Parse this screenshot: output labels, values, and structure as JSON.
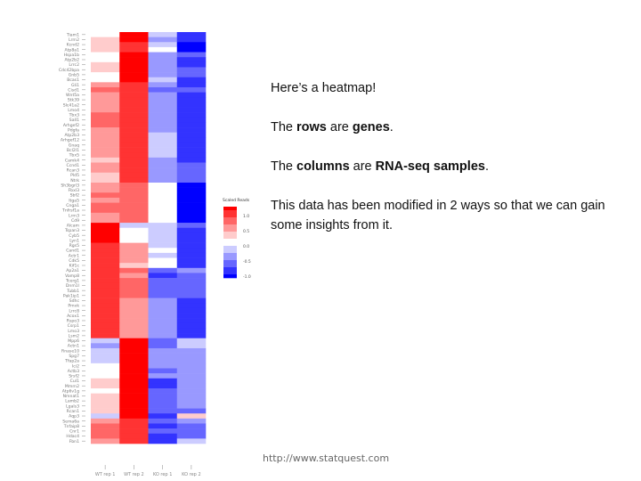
{
  "slide": {
    "notes": [
      {
        "parts": [
          {
            "t": "Here’s a heatmap!",
            "b": false
          }
        ]
      },
      {
        "parts": [
          {
            "t": "The ",
            "b": false
          },
          {
            "t": "rows",
            "b": true
          },
          {
            "t": " are ",
            "b": false
          },
          {
            "t": "genes",
            "b": true
          },
          {
            "t": ".",
            "b": false
          }
        ]
      },
      {
        "parts": [
          {
            "t": "The ",
            "b": false
          },
          {
            "t": "columns",
            "b": true
          },
          {
            "t": " are ",
            "b": false
          },
          {
            "t": "RNA-seq samples",
            "b": true
          },
          {
            "t": ".",
            "b": false
          }
        ]
      },
      {
        "parts": [
          {
            "t": "This data has been modified in 2 ways so that we can gain some insights from it.",
            "b": false
          }
        ]
      }
    ],
    "footer": "http://www.statquest.com"
  },
  "chart_data": {
    "type": "heatmap",
    "title": "",
    "xlabel": "",
    "ylabel": "",
    "color_key": {
      "title": "Scaled Reads",
      "ticks": [
        "1.0",
        "0.5",
        "0.0",
        "-0.5",
        "-1.0"
      ],
      "range": [
        -1,
        1
      ],
      "low_color": "#0000ff",
      "mid_color": "#ffffff",
      "high_color": "#ff0000"
    },
    "columns": [
      "WT rep 1",
      "WT rep 2",
      "KO rep 1",
      "KO rep 2"
    ],
    "rows": [
      "Tiam1",
      "Lrrn2",
      "Kcnd2",
      "Atp8a1",
      "Hspa1b",
      "Atp2b2",
      "Lrrc2",
      "Cdc42bpa",
      "Gnb5",
      "Bcas1",
      "Gli1",
      "Cisd1",
      "Wnt5a",
      "Stk39",
      "Slc41a2",
      "Lmo4",
      "Tbx3",
      "Sall1",
      "Arhgef2",
      "Pdgfa",
      "Atp2b3",
      "Arhgef12",
      "Gnaq",
      "Bcl2l1",
      "Tbx5",
      "Camk4",
      "Ccnd1",
      "Rcan3",
      "Pld5",
      "Ntrk",
      "Sh3bgrl3",
      "Fbxl3",
      "Sbf2",
      "Itga5",
      "Cnga1",
      "Tnfrsf1a",
      "Lrrn3",
      "Cd9",
      "Alcam",
      "Tspan3",
      "Cyb5",
      "Lyn1",
      "Rgs5",
      "Cand1",
      "Actr1",
      "Cdk5",
      "Kif1c",
      "Ap2a1",
      "Vamp8",
      "Tcerg1",
      "Dnm1l",
      "Tubb1",
      "Pak1ip1",
      "Sdhc",
      "Pmvk",
      "Lrrc8",
      "Acox1",
      "Rspo3",
      "Csrp1",
      "Lmo3",
      "Lsm2",
      "Mpp6",
      "Actn1",
      "Rnase10",
      "Spg7",
      "Tfap2a",
      "Ici2",
      "Actb3",
      "Srsf2",
      "Cul1",
      "Mmrn2",
      "Atp6v1g",
      "Nmnat1",
      "Lamb2",
      "Lgals3",
      "Rcan1",
      "Aqp3",
      "Sema6a",
      "Tnfaip8",
      "Cnr1",
      "Hdac4",
      "Fbn1"
    ],
    "values": [
      [
        0.08,
        0.92,
        -0.3,
        -0.78
      ],
      [
        0.1,
        0.92,
        -0.35,
        -0.8
      ],
      [
        0.12,
        0.88,
        -0.15,
        -0.9
      ],
      [
        0.22,
        0.85,
        -0.1,
        -0.92
      ],
      [
        0.04,
        0.95,
        -0.45,
        -0.7
      ],
      [
        0.05,
        0.95,
        -0.4,
        -0.72
      ],
      [
        0.1,
        0.93,
        -0.38,
        -0.75
      ],
      [
        0.12,
        0.95,
        -0.4,
        -0.7
      ],
      [
        -0.08,
        0.98,
        -0.32,
        -0.68
      ],
      [
        -0.1,
        0.97,
        -0.28,
        -0.72
      ],
      [
        0.45,
        0.8,
        -0.5,
        -0.72
      ],
      [
        0.5,
        0.78,
        -0.52,
        -0.7
      ],
      [
        0.38,
        0.8,
        -0.4,
        -0.75
      ],
      [
        0.4,
        0.8,
        -0.38,
        -0.75
      ],
      [
        0.42,
        0.78,
        -0.4,
        -0.76
      ],
      [
        0.48,
        0.8,
        -0.45,
        -0.75
      ],
      [
        0.52,
        0.72,
        -0.42,
        -0.76
      ],
      [
        0.5,
        0.72,
        -0.4,
        -0.78
      ],
      [
        0.55,
        0.7,
        -0.45,
        -0.78
      ],
      [
        0.48,
        0.72,
        -0.38,
        -0.8
      ],
      [
        0.4,
        0.75,
        -0.3,
        -0.82
      ],
      [
        0.42,
        0.72,
        -0.25,
        -0.85
      ],
      [
        0.45,
        0.72,
        -0.28,
        -0.8
      ],
      [
        0.4,
        0.78,
        -0.22,
        -0.84
      ],
      [
        0.35,
        0.78,
        -0.2,
        -0.85
      ],
      [
        0.28,
        0.85,
        -0.35,
        -0.72
      ],
      [
        0.3,
        0.85,
        -0.38,
        -0.7
      ],
      [
        0.32,
        0.82,
        -0.4,
        -0.7
      ],
      [
        0.22,
        0.88,
        -0.42,
        -0.68
      ],
      [
        0.25,
        0.88,
        -0.48,
        -0.65
      ],
      [
        0.45,
        0.6,
        -0.08,
        -0.92
      ],
      [
        0.45,
        0.6,
        -0.1,
        -0.92
      ],
      [
        0.5,
        0.58,
        -0.05,
        -0.9
      ],
      [
        0.48,
        0.55,
        0.0,
        -0.92
      ],
      [
        0.5,
        0.55,
        0.02,
        -0.95
      ],
      [
        0.52,
        0.52,
        0.05,
        -0.95
      ],
      [
        0.42,
        0.55,
        0.08,
        -0.97
      ],
      [
        0.48,
        0.55,
        0.05,
        -0.98
      ],
      [
        0.95,
        -0.15,
        -0.22,
        -0.7
      ],
      [
        0.92,
        -0.05,
        -0.25,
        -0.72
      ],
      [
        0.9,
        -0.02,
        -0.15,
        -0.78
      ],
      [
        0.9,
        -0.05,
        -0.12,
        -0.8
      ],
      [
        0.8,
        0.3,
        -0.18,
        -0.78
      ],
      [
        0.8,
        0.35,
        -0.1,
        -0.8
      ],
      [
        0.78,
        0.38,
        -0.12,
        -0.82
      ],
      [
        0.82,
        0.35,
        -0.08,
        -0.78
      ],
      [
        0.8,
        0.28,
        -0.05,
        -0.85
      ],
      [
        0.8,
        0.5,
        -0.7,
        -0.5
      ],
      [
        0.85,
        0.45,
        -0.72,
        -0.55
      ],
      [
        0.82,
        0.5,
        -0.6,
        -0.55
      ],
      [
        0.75,
        0.52,
        -0.6,
        -0.62
      ],
      [
        0.78,
        0.55,
        -0.58,
        -0.6
      ],
      [
        0.72,
        0.55,
        -0.55,
        -0.65
      ],
      [
        0.8,
        0.45,
        -0.45,
        -0.72
      ],
      [
        0.8,
        0.48,
        -0.42,
        -0.75
      ],
      [
        0.78,
        0.45,
        -0.4,
        -0.75
      ],
      [
        0.8,
        0.45,
        -0.42,
        -0.76
      ],
      [
        0.78,
        0.42,
        -0.4,
        -0.78
      ],
      [
        0.8,
        0.4,
        -0.35,
        -0.8
      ],
      [
        0.82,
        0.35,
        -0.38,
        -0.78
      ],
      [
        0.8,
        0.3,
        -0.4,
        -0.75
      ],
      [
        -0.25,
        1.0,
        -0.6,
        -0.22
      ],
      [
        -0.35,
        1.0,
        -0.55,
        -0.3
      ],
      [
        -0.15,
        1.0,
        -0.5,
        -0.4
      ],
      [
        -0.18,
        1.0,
        -0.5,
        -0.45
      ],
      [
        -0.2,
        1.0,
        -0.48,
        -0.45
      ],
      [
        -0.05,
        1.0,
        -0.5,
        -0.5
      ],
      [
        -0.05,
        1.0,
        -0.52,
        -0.5
      ],
      [
        -0.08,
        0.98,
        -0.5,
        -0.48
      ],
      [
        0.2,
        0.92,
        -0.75,
        -0.35
      ],
      [
        0.15,
        0.93,
        -0.72,
        -0.32
      ],
      [
        0.05,
        0.95,
        -0.7,
        -0.38
      ],
      [
        0.18,
        0.93,
        -0.62,
        -0.45
      ],
      [
        0.22,
        0.92,
        -0.6,
        -0.5
      ],
      [
        0.2,
        0.92,
        -0.55,
        -0.48
      ],
      [
        0.15,
        0.9,
        -0.6,
        -0.55
      ],
      [
        -0.15,
        0.9,
        -0.85,
        0.12
      ],
      [
        0.45,
        0.85,
        -0.65,
        -0.5
      ],
      [
        0.5,
        0.8,
        -0.72,
        -0.52
      ],
      [
        0.55,
        0.78,
        -0.7,
        -0.55
      ],
      [
        0.6,
        0.75,
        -0.78,
        -0.58
      ],
      [
        0.35,
        0.85,
        -0.85,
        -0.3
      ]
    ]
  }
}
